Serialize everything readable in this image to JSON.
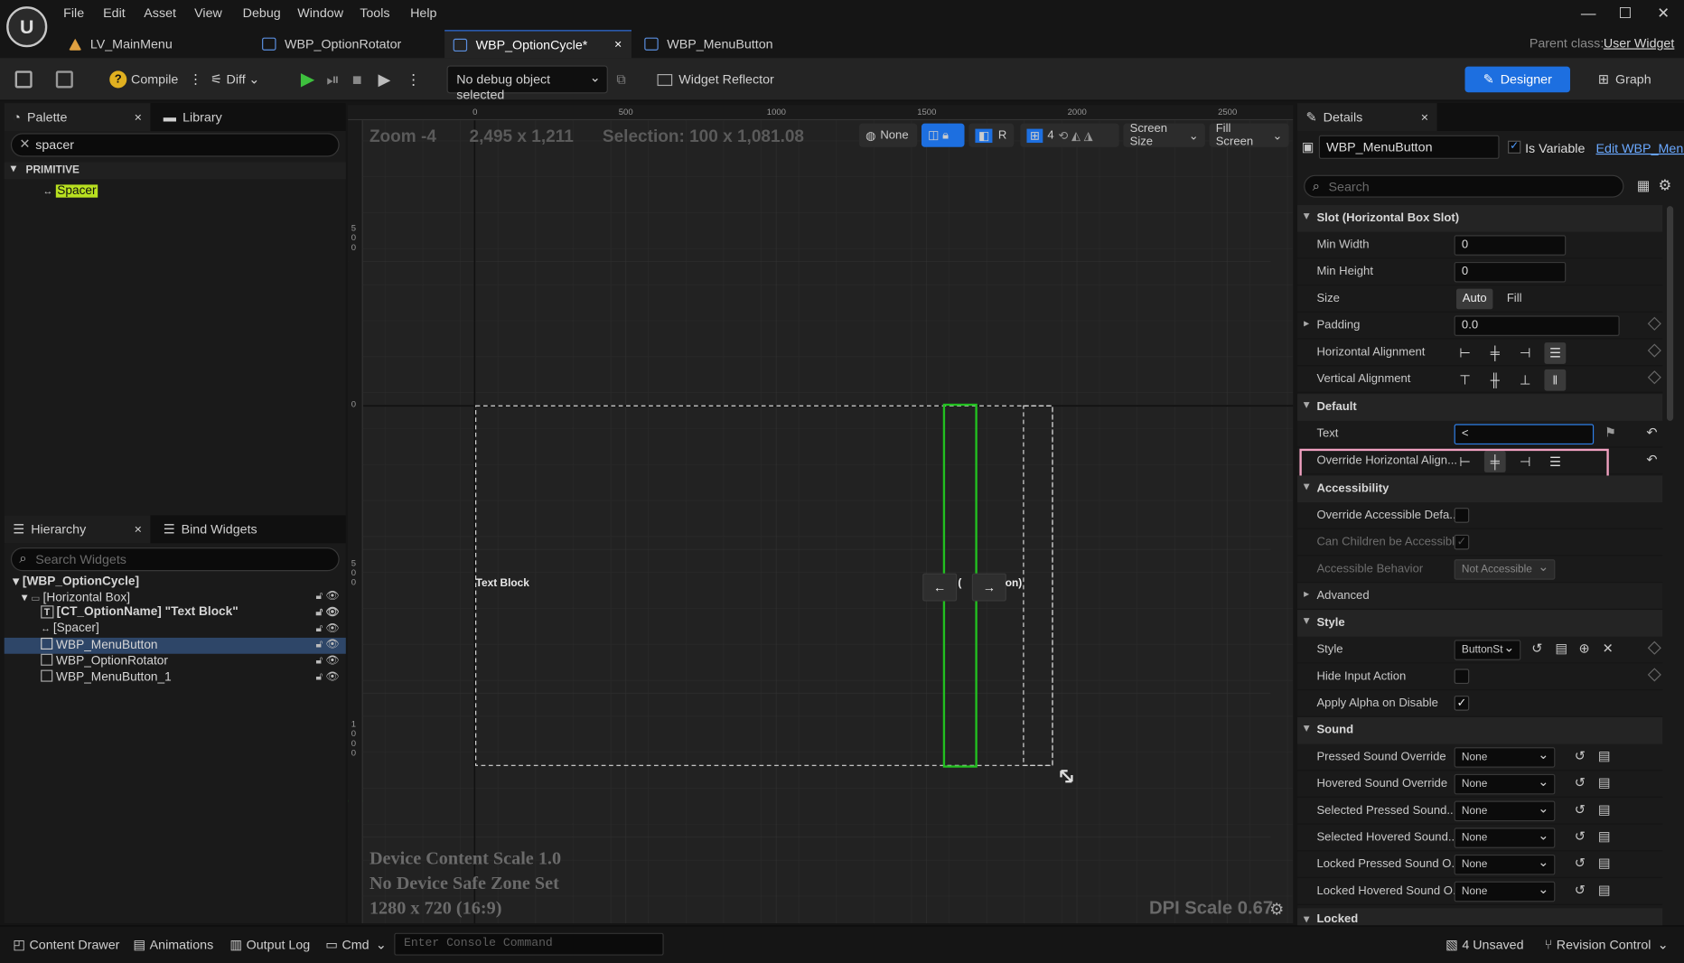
{
  "menu": [
    "File",
    "Edit",
    "Asset",
    "View",
    "Debug",
    "Window",
    "Tools",
    "Help"
  ],
  "tabs": [
    {
      "label": "LV_MainMenu"
    },
    {
      "label": "WBP_OptionRotator"
    },
    {
      "label": "WBP_OptionCycle*"
    },
    {
      "label": "WBP_MenuButton"
    }
  ],
  "parent_class": {
    "label": "Parent class:",
    "value": "User Widget"
  },
  "toolbar": {
    "compile": "Compile",
    "diff": "Diff",
    "debug_object": "No debug object selected",
    "widget_reflector": "Widget Reflector",
    "designer": "Designer",
    "graph": "Graph"
  },
  "palette": {
    "tab": "Palette",
    "library_tab": "Library",
    "search_value": "spacer",
    "category": "PRIMITIVE",
    "item": "Spacer"
  },
  "hierarchy": {
    "tab": "Hierarchy",
    "bind_tab": "Bind Widgets",
    "search_placeholder": "Search Widgets",
    "items": [
      "[WBP_OptionCycle]",
      "[Horizontal Box]",
      "[CT_OptionName] \"Text Block\"",
      "[Spacer]",
      "WBP_MenuButton",
      "WBP_OptionRotator",
      "WBP_MenuButton_1"
    ]
  },
  "viewport": {
    "zoom": "Zoom -4",
    "resolution": "2,495 x 1,211",
    "selection": "Selection: 100 x 1,081.08",
    "none_label": "None",
    "r_label": "R",
    "grid_num": "4",
    "screen_size": "Screen Size",
    "fill_screen": "Fill Screen",
    "ruler_top": [
      "0",
      "500",
      "1000",
      "1500",
      "2000",
      "2500"
    ],
    "ruler_left": [
      "5 0 0",
      "0",
      "5 0 0",
      "1 0 0 0"
    ],
    "text_block": "Text Block",
    "left_arrow": "←",
    "right_arrow": "→",
    "clipped_text": "on)",
    "device_scale": "Device Content Scale 1.0",
    "safe_zone": "No Device Safe Zone Set",
    "device_res": "1280 x 720 (16:9)",
    "dpi": "DPI Scale 0.67"
  },
  "details": {
    "tab": "Details",
    "widget_name": "WBP_MenuButton",
    "is_variable": "Is Variable",
    "edit_link": "Edit WBP_Menu",
    "search_placeholder": "Search",
    "sections": {
      "slot": "Slot (Horizontal Box Slot)",
      "default": "Default",
      "accessibility": "Accessibility",
      "advanced": "Advanced",
      "style": "Style",
      "sound": "Sound",
      "locked": "Locked"
    },
    "min_width": {
      "label": "Min Width",
      "value": "0"
    },
    "min_height": {
      "label": "Min Height",
      "value": "0"
    },
    "size": {
      "label": "Size",
      "auto": "Auto",
      "fill": "Fill"
    },
    "padding": {
      "label": "Padding",
      "value": "0.0"
    },
    "h_align": "Horizontal Alignment",
    "v_align": "Vertical Alignment",
    "text": {
      "label": "Text",
      "value": "<"
    },
    "override_align": "Override Horizontal Align...",
    "override_acc": "Override Accessible Defa...",
    "children_acc": "Can Children be Accessible",
    "acc_behavior": {
      "label": "Accessible Behavior",
      "value": "Not Accessible"
    },
    "style": {
      "label": "Style",
      "value": "ButtonSt"
    },
    "hide_input": "Hide Input Action",
    "apply_alpha": "Apply Alpha on Disable",
    "sounds": [
      {
        "label": "Pressed Sound Override",
        "value": "None"
      },
      {
        "label": "Hovered Sound Override",
        "value": "None"
      },
      {
        "label": "Selected Pressed Sound...",
        "value": "None"
      },
      {
        "label": "Selected Hovered Sound...",
        "value": "None"
      },
      {
        "label": "Locked Pressed Sound O...",
        "value": "None"
      },
      {
        "label": "Locked Hovered Sound O...",
        "value": "None"
      }
    ]
  },
  "statusbar": {
    "content_drawer": "Content Drawer",
    "animations": "Animations",
    "output_log": "Output Log",
    "cmd": "Cmd",
    "console_placeholder": "Enter Console Command",
    "unsaved": "4 Unsaved",
    "revision": "Revision Control"
  },
  "colors": {
    "accent": "#1d6fe0",
    "selection_green": "#22c020",
    "highlight_pink": "#f0a0c0"
  }
}
